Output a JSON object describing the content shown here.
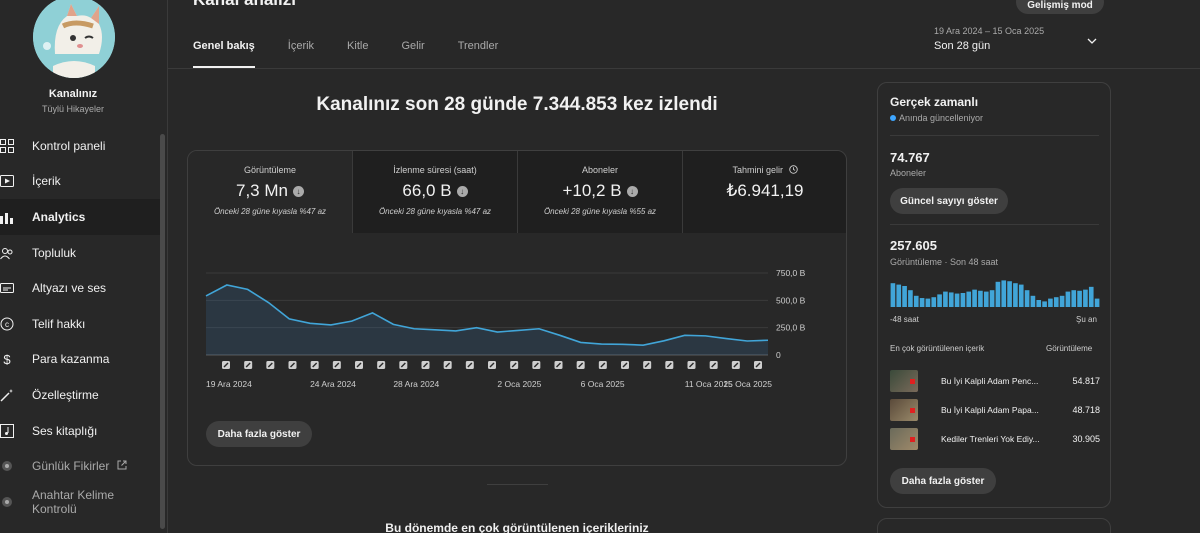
{
  "channel": {
    "name": "Kanalınız",
    "subtitle": "Tüylü Hikayeler"
  },
  "nav": [
    {
      "label": "Kontrol paneli",
      "icon": "dashboard-icon"
    },
    {
      "label": "İçerik",
      "icon": "content-icon"
    },
    {
      "label": "Analytics",
      "icon": "analytics-icon",
      "active": true
    },
    {
      "label": "Topluluk",
      "icon": "community-icon"
    },
    {
      "label": "Altyazı ve ses",
      "icon": "subtitles-icon"
    },
    {
      "label": "Telif hakkı",
      "icon": "copyright-icon"
    },
    {
      "label": "Para kazanma",
      "icon": "dollar-icon"
    },
    {
      "label": "Özelleştirme",
      "icon": "magic-wand-icon"
    },
    {
      "label": "Ses kitaplığı",
      "icon": "music-library-icon"
    },
    {
      "label": "Günlük Fikirler",
      "icon": "extension-icon",
      "muted": true
    },
    {
      "label": "Anahtar Kelime Kontrolü",
      "icon": "extension-icon",
      "muted": true
    }
  ],
  "header": {
    "title": "Kanal analizi",
    "advanced_mode": "Gelişmiş mod",
    "tabs": [
      "Genel bakış",
      "İçerik",
      "Kitle",
      "Gelir",
      "Trendler"
    ],
    "date_range": "19 Ara 2024 – 15 Oca 2025",
    "period": "Son 28 gün"
  },
  "headline": "Kanalınız son 28 günde 7.344.853 kez izlendi",
  "metrics": [
    {
      "label": "Görüntüleme",
      "value": "7,3 Mn",
      "comparison": "Önceki 28 güne kıyasla %47 az",
      "trend": "down"
    },
    {
      "label": "İzlenme süresi (saat)",
      "value": "66,0 B",
      "comparison": "Önceki 28 güne kıyasla %47 az",
      "trend": "down"
    },
    {
      "label": "Aboneler",
      "value": "+10,2 B",
      "comparison": "Önceki 28 güne kıyasla %55 az",
      "trend": "down"
    },
    {
      "label": "Tahmini gelir",
      "value": "₺6.941,19",
      "comparison": "",
      "trend": "none"
    }
  ],
  "chart_data": {
    "type": "area",
    "y_ticks": [
      "750,0 B",
      "500,0 B",
      "250,0 B",
      "0"
    ],
    "ylim": [
      0,
      750000
    ],
    "x_labels": [
      "19 Ara 2024",
      "24 Ara 2024",
      "28 Ara 2024",
      "2 Oca 2025",
      "6 Oca 2025",
      "11 Oca 2025",
      "15 Oca 2025"
    ],
    "x": [
      "19 Ara",
      "20 Ara",
      "21 Ara",
      "22 Ara",
      "23 Ara",
      "24 Ara",
      "25 Ara",
      "26 Ara",
      "27 Ara",
      "28 Ara",
      "29 Ara",
      "30 Ara",
      "31 Ara",
      "1 Oca",
      "2 Oca",
      "3 Oca",
      "4 Oca",
      "5 Oca",
      "6 Oca",
      "7 Oca",
      "8 Oca",
      "9 Oca",
      "10 Oca",
      "11 Oca",
      "12 Oca",
      "13 Oca",
      "14 Oca",
      "15 Oca"
    ],
    "series": [
      {
        "values": [
          540000,
          640000,
          600000,
          480000,
          330000,
          290000,
          275000,
          310000,
          385000,
          280000,
          240000,
          230000,
          220000,
          250000,
          210000,
          225000,
          240000,
          180000,
          115000,
          100000,
          98000,
          90000,
          130000,
          180000,
          175000,
          150000,
          128000,
          135000
        ]
      }
    ],
    "upload_markers": 25,
    "grid": true
  },
  "chart_more": "Daha fazla göster",
  "realtime": {
    "title": "Gerçek zamanlı",
    "live_label": "Anında güncelleniyor",
    "subscribers": "74.767",
    "subscribers_label": "Aboneler",
    "show_count_btn": "Güncel sayıyı göster",
    "views": "257.605",
    "views_label": "Görüntüleme · Son 48 saat",
    "bars": [
      0.85,
      0.8,
      0.75,
      0.6,
      0.4,
      0.32,
      0.3,
      0.35,
      0.45,
      0.55,
      0.52,
      0.48,
      0.5,
      0.55,
      0.62,
      0.58,
      0.55,
      0.6,
      0.9,
      0.95,
      0.92,
      0.85,
      0.8,
      0.6,
      0.4,
      0.25,
      0.2,
      0.3,
      0.35,
      0.4,
      0.55,
      0.6,
      0.58,
      0.62,
      0.72,
      0.3
    ],
    "bars_left": "-48 saat",
    "bars_right": "Şu an",
    "top_header_left": "En çok görüntülenen içerik",
    "top_header_right": "Görüntüleme",
    "top_items": [
      {
        "title": "Bu İyi Kalpli Adam Penc...",
        "value": "54.817"
      },
      {
        "title": "Bu İyi Kalpli Adam Papa...",
        "value": "48.718"
      },
      {
        "title": "Kediler Trenleri Yok Ediy...",
        "value": "30.905"
      }
    ],
    "more_btn": "Daha fazla göster"
  },
  "bottom_title": "Bu dönemde en çok görüntülenen içerikleriniz",
  "colors": {
    "accent": "#3ea6ff",
    "bg": "#282828",
    "card": "#1f1f1f"
  }
}
